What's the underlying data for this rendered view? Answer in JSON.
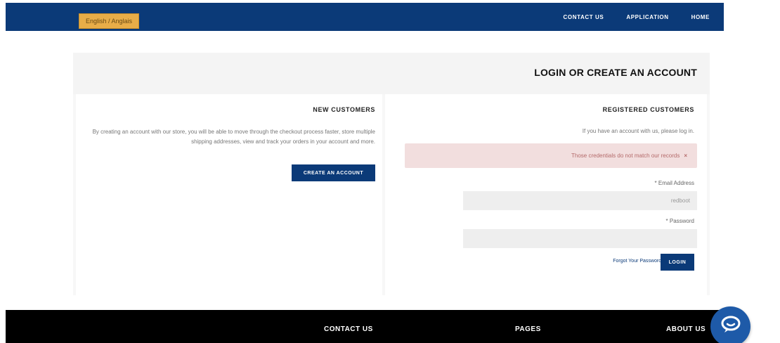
{
  "header": {
    "language_label": "English / Anglais",
    "nav": [
      {
        "label": "CONTACT US"
      },
      {
        "label": "APPLICATION"
      },
      {
        "label": "HOME"
      }
    ]
  },
  "page": {
    "title": "LOGIN OR CREATE AN ACCOUNT"
  },
  "new_customers": {
    "title": "NEW CUSTOMERS",
    "description": "By creating an account with our store, you will be able to move through the checkout process faster, store multiple shipping addresses, view and track your orders in your account and more.",
    "create_button": "CREATE AN ACCOUNT"
  },
  "registered": {
    "title": "REGISTERED CUSTOMERS",
    "hint": "If you have an account with us, please log in.",
    "error": "Those credentials do not match our records",
    "email_label": "* Email Address",
    "email_value": "redboot",
    "password_label": "* Password",
    "password_value": "",
    "forgot_link": "Forgot Your Password?",
    "login_button": "LOGIN"
  },
  "footer": {
    "columns": [
      {
        "label": "CONTACT US"
      },
      {
        "label": "PAGES"
      },
      {
        "label": "ABOUT US"
      }
    ]
  },
  "icons": {
    "chat": "chat-icon",
    "close": "close-icon"
  },
  "colors": {
    "primary": "#0b3a78",
    "accent": "#e8ad48",
    "error_bg": "#f2dede"
  }
}
